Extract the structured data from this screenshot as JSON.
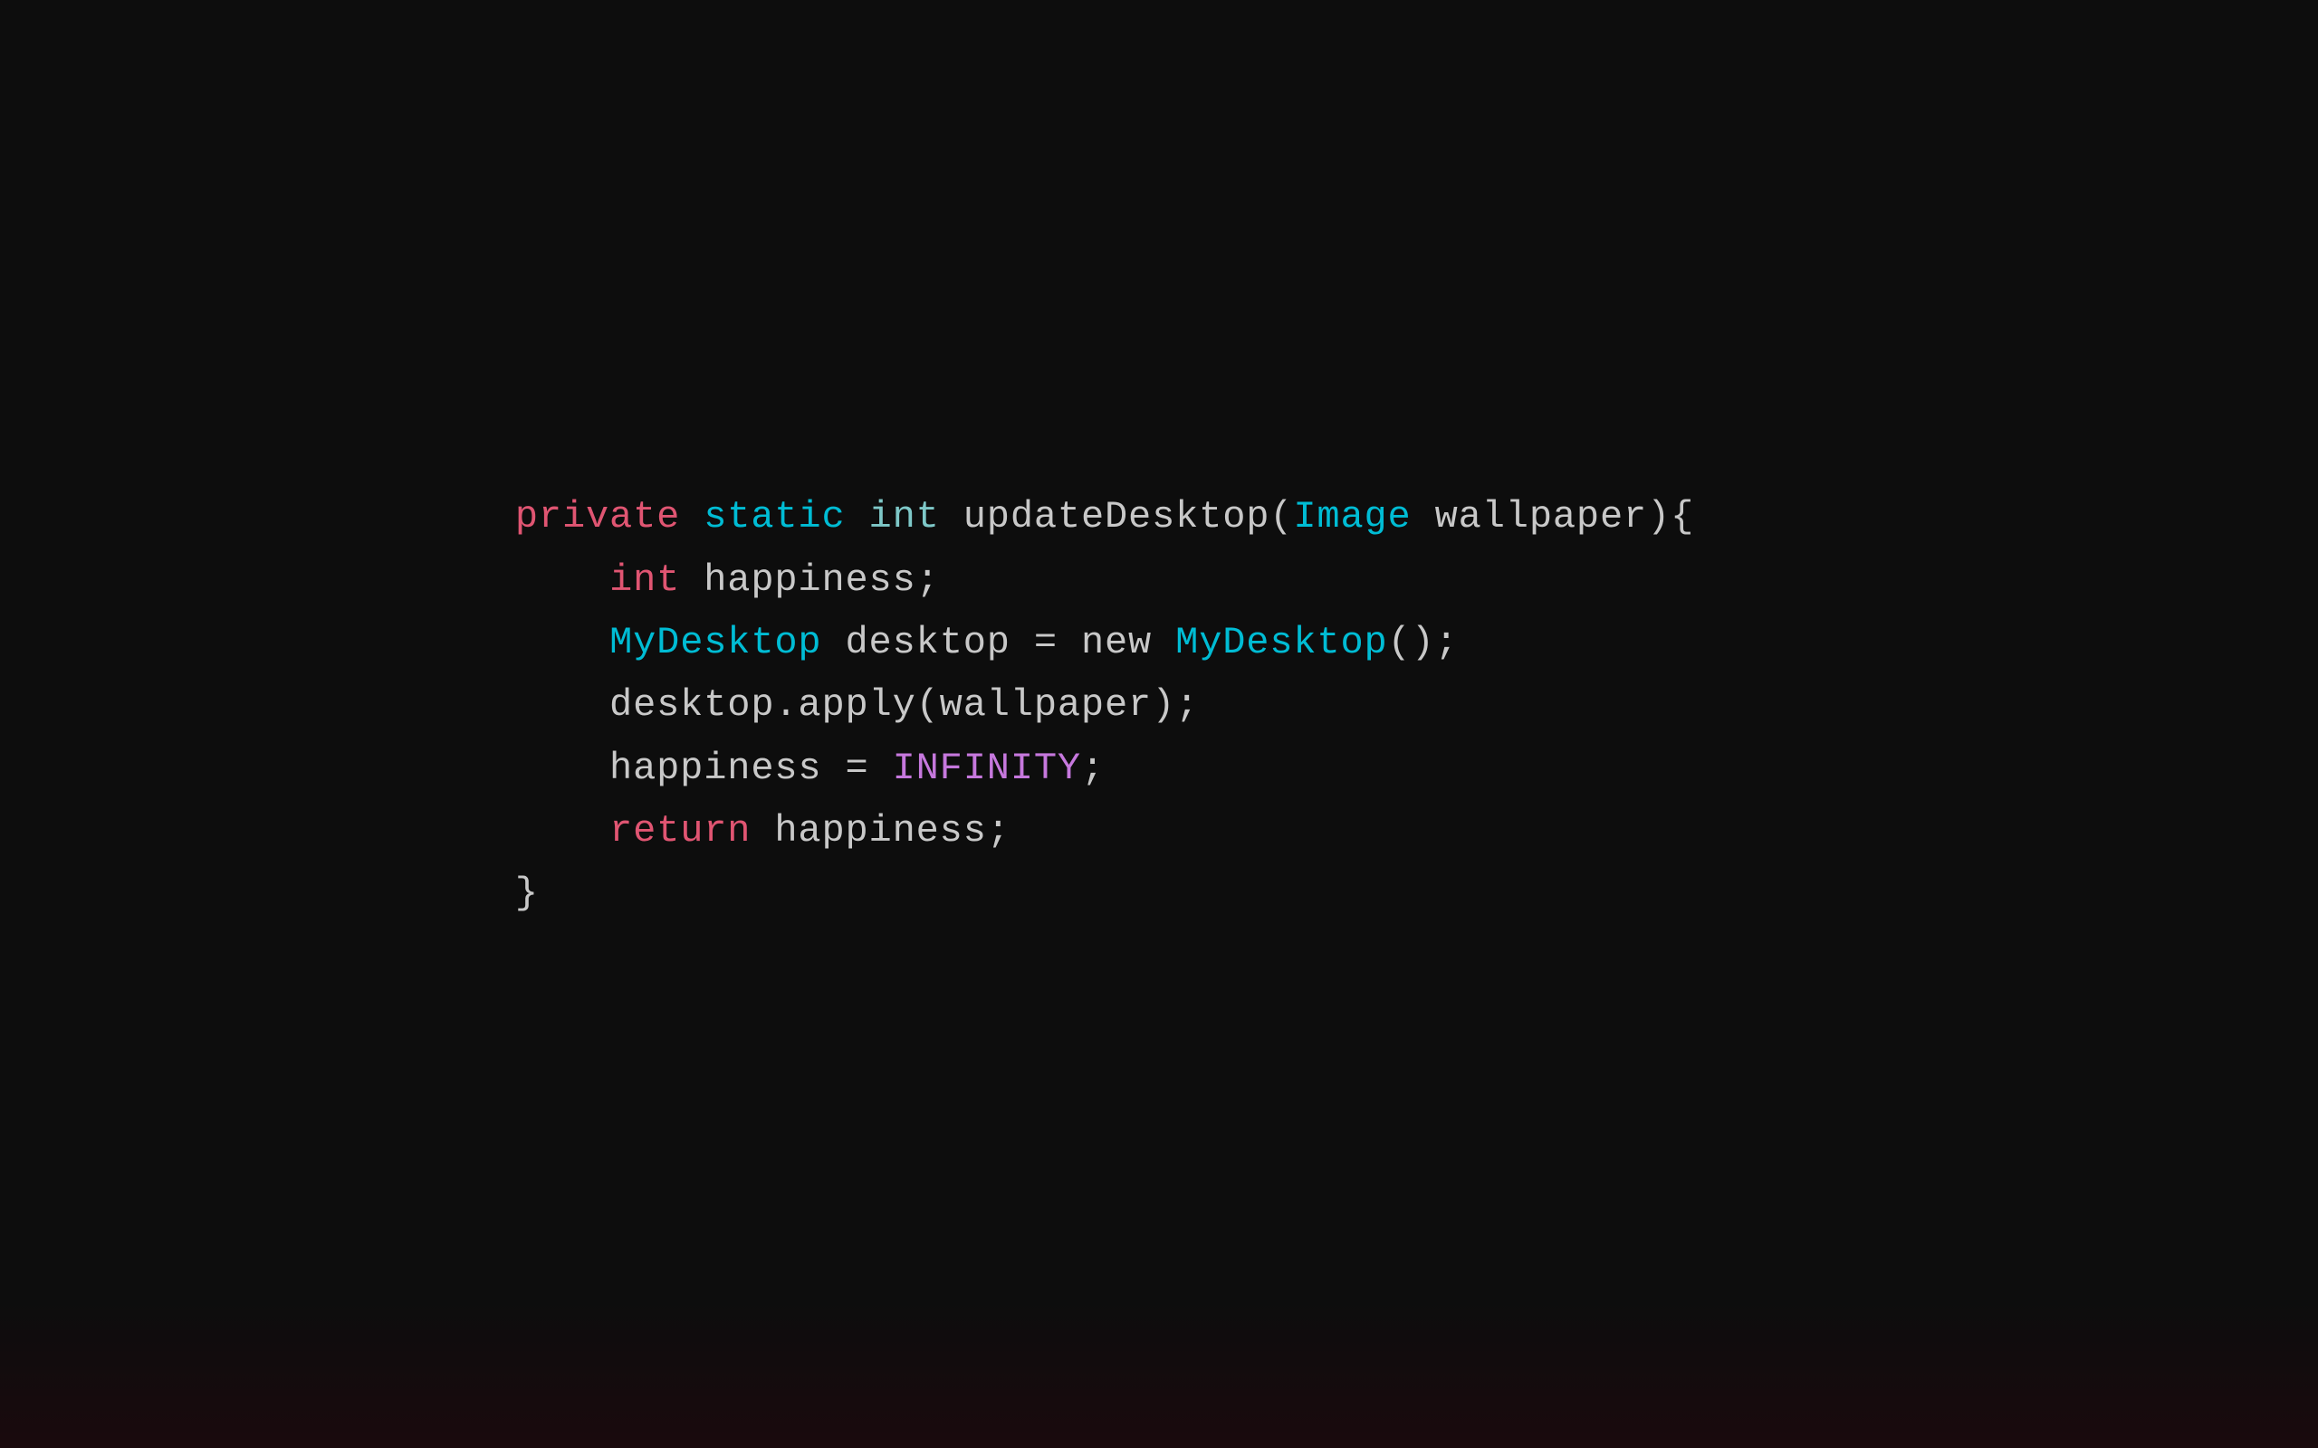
{
  "background": "#0d0d0d",
  "code": {
    "line1": {
      "parts": [
        {
          "text": "private",
          "class": "kw-private"
        },
        {
          "text": " ",
          "class": "plain"
        },
        {
          "text": "static",
          "class": "kw-static"
        },
        {
          "text": " ",
          "class": "plain"
        },
        {
          "text": "int",
          "class": "kw-int"
        },
        {
          "text": " updateDesktop(",
          "class": "plain"
        },
        {
          "text": "Image",
          "class": "type-image"
        },
        {
          "text": " wallpaper){",
          "class": "plain"
        }
      ]
    },
    "line2": {
      "indent": "    ",
      "parts": [
        {
          "text": "    "
        },
        {
          "text": "int",
          "class": "kw-int-red"
        },
        {
          "text": " happiness;",
          "class": "plain"
        }
      ]
    },
    "line3": {
      "parts": [
        {
          "text": "    "
        },
        {
          "text": "MyDesktop",
          "class": "type-mydesktop"
        },
        {
          "text": " desktop = ",
          "class": "plain"
        },
        {
          "text": "new",
          "class": "plain"
        },
        {
          "text": " ",
          "class": "plain"
        },
        {
          "text": "MyDesktop",
          "class": "type-mydesktop"
        },
        {
          "text": "();",
          "class": "plain"
        }
      ]
    },
    "line4": {
      "parts": [
        {
          "text": "    desktop.apply(wallpaper);",
          "class": "plain"
        }
      ]
    },
    "line5": {
      "parts": [
        {
          "text": "    happiness = ",
          "class": "plain"
        },
        {
          "text": "INFINITY",
          "class": "const-infinity"
        },
        {
          "text": ";",
          "class": "plain"
        }
      ]
    },
    "line6": {
      "parts": [
        {
          "text": "    "
        },
        {
          "text": "return",
          "class": "kw-return"
        },
        {
          "text": " happiness;",
          "class": "plain"
        }
      ]
    },
    "line7": {
      "parts": [
        {
          "text": "}",
          "class": "brace"
        }
      ]
    }
  }
}
